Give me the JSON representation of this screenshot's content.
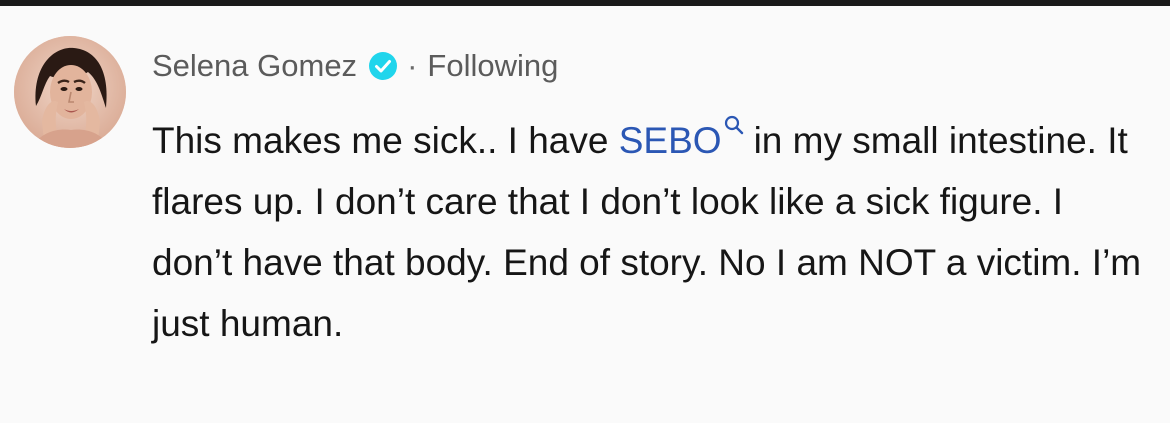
{
  "post": {
    "author": "Selena Gomez",
    "separator": "·",
    "follow_status": "Following",
    "text_before": "This makes me sick.. I have ",
    "link_term": "SEBO",
    "text_after": "in my small intestine. It flares up. I don’t care that I don’t look like a sick figure. I don’t have that body. End of story. No I am NOT a victim. I’m just human."
  },
  "icons": {
    "verified": "verified-badge-icon",
    "search": "search-icon",
    "avatar": "profile-photo"
  },
  "colors": {
    "verified_badge": "#20d5ec",
    "link": "#2b57b4",
    "top_bar": "#1a1a1a"
  }
}
